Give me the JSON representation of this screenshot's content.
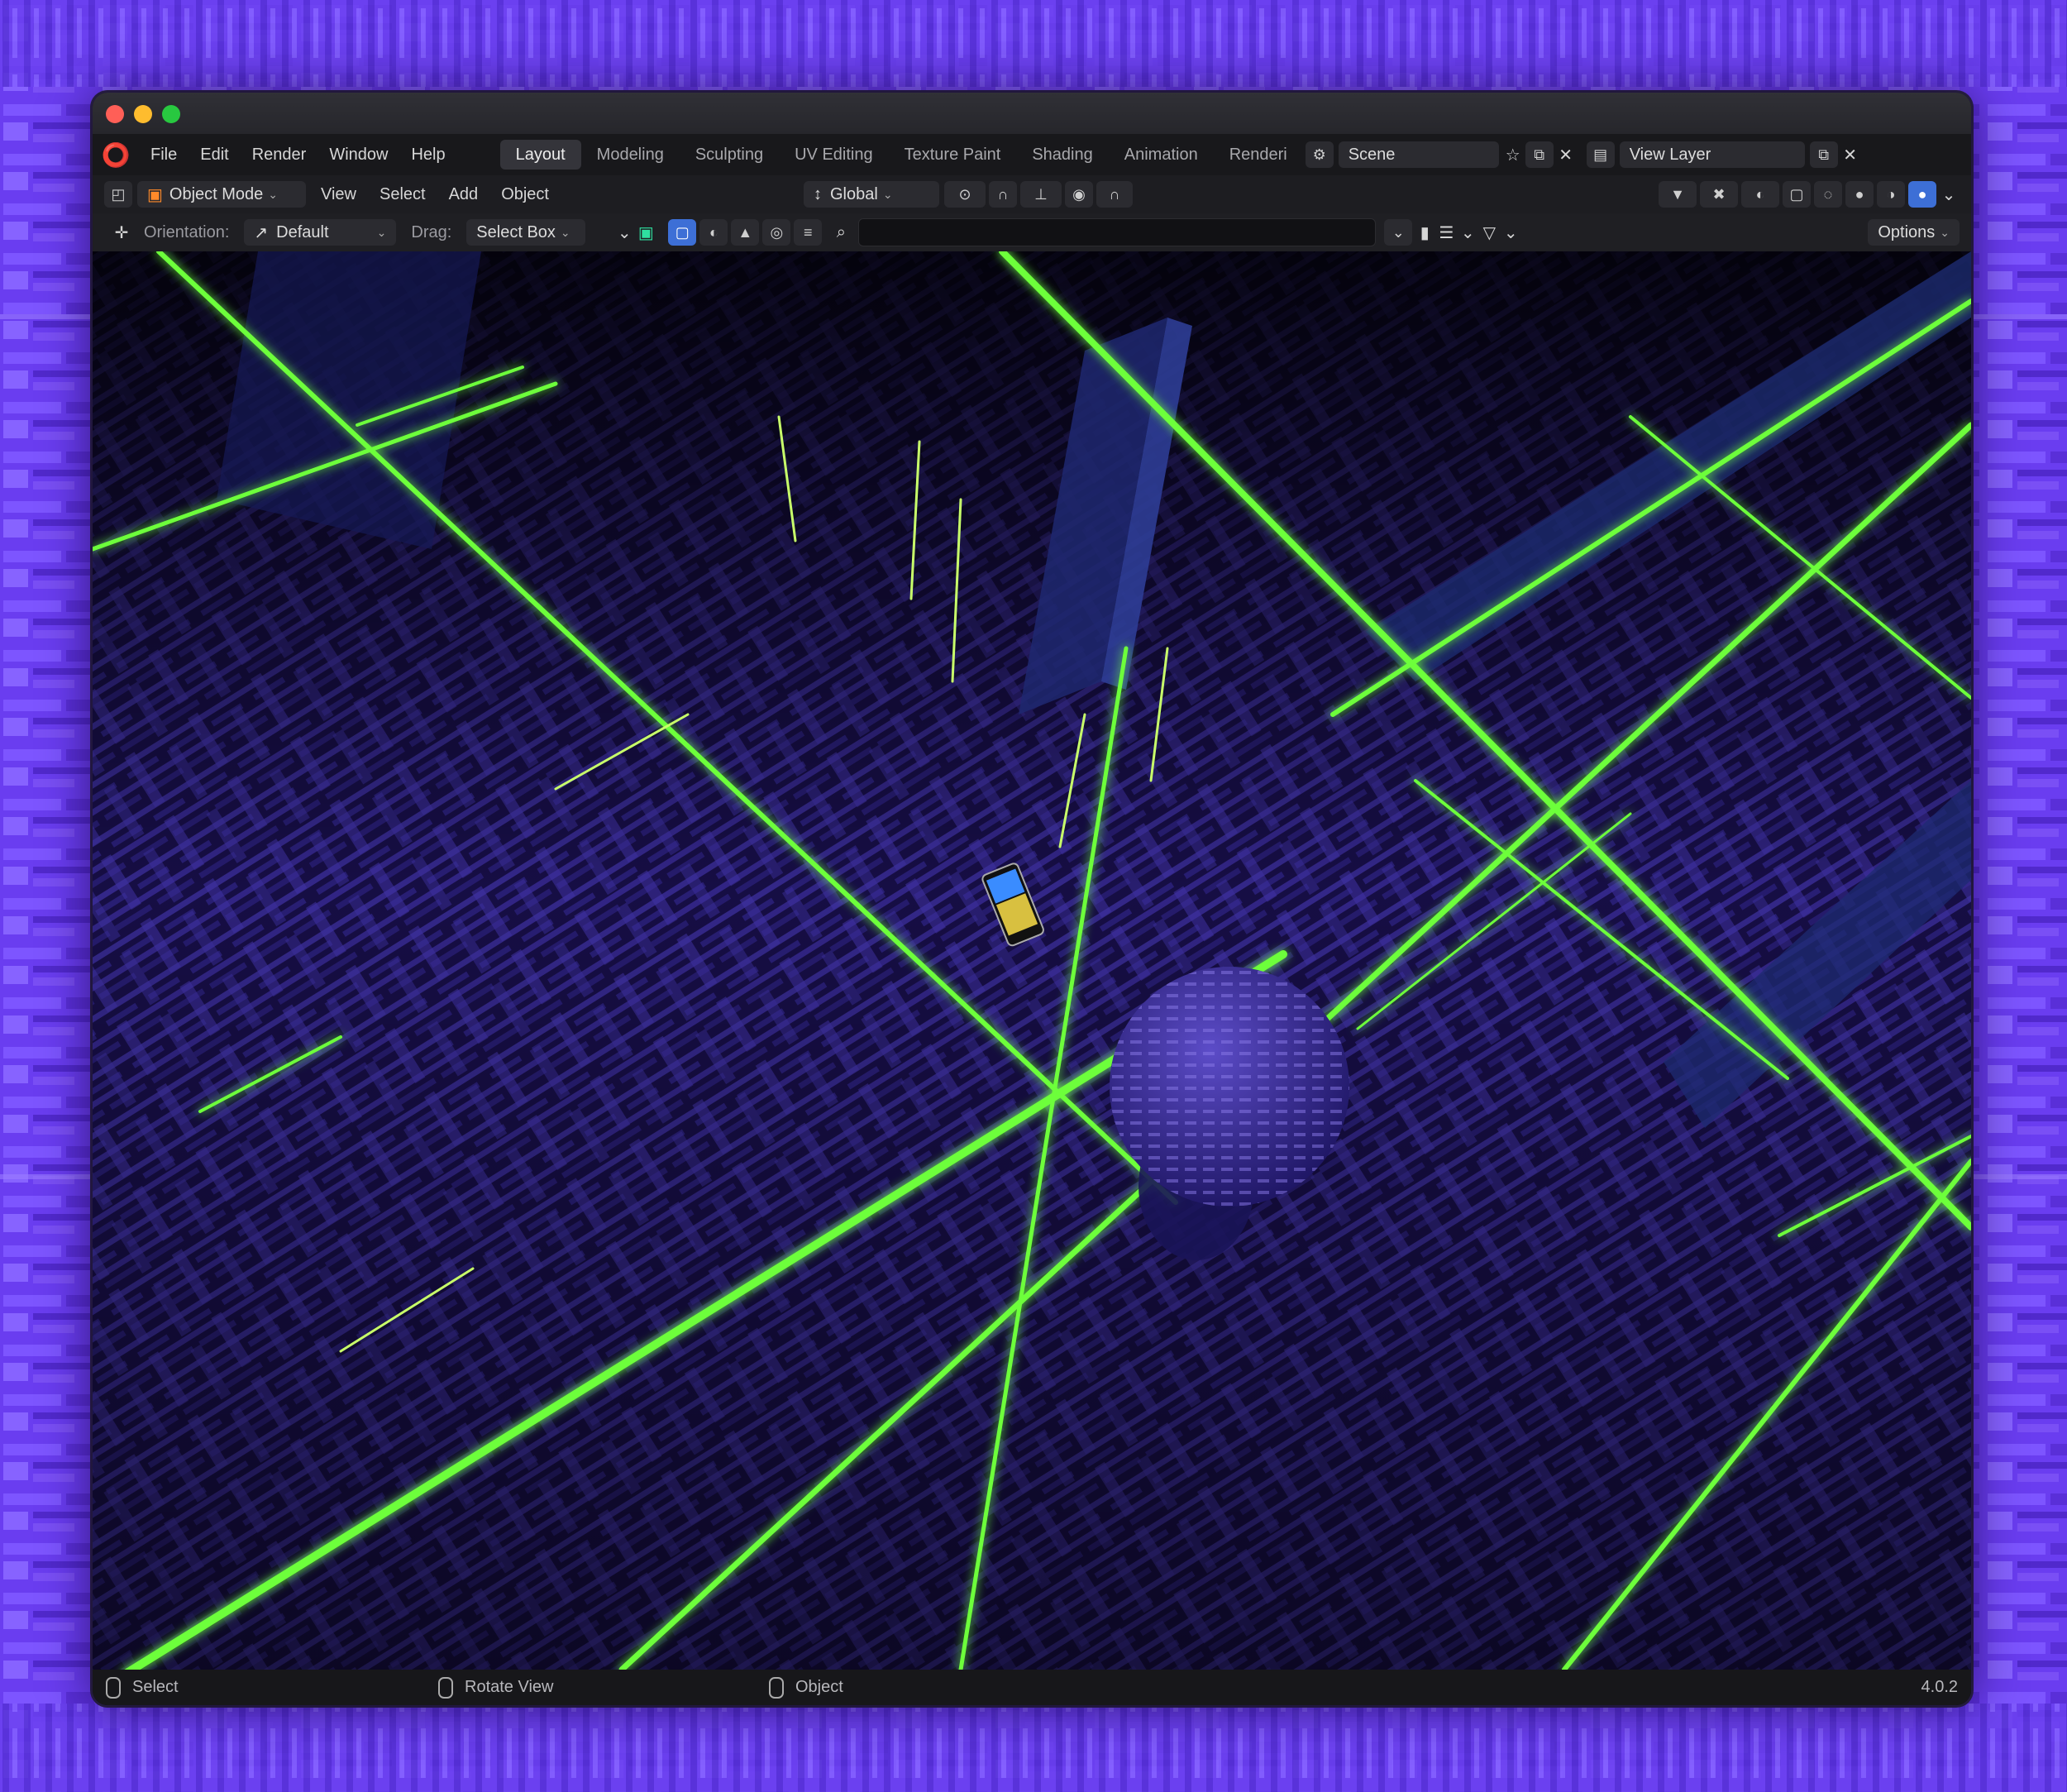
{
  "window": {
    "traffic_lights": {
      "close_color": "#ff5f57",
      "minimize_color": "#febc2e",
      "zoom_color": "#28c840"
    }
  },
  "menubar": {
    "logo_icon": "blender-logo-icon",
    "menus": [
      "File",
      "Edit",
      "Render",
      "Window",
      "Help"
    ],
    "tabs": [
      "Layout",
      "Modeling",
      "Sculpting",
      "UV Editing",
      "Texture Paint",
      "Shading",
      "Animation",
      "Renderi"
    ],
    "active_tab": "Layout",
    "scene_field": "Scene",
    "view_layer_field": "View Layer"
  },
  "header": {
    "editor_type_icon": "3d-viewport-icon",
    "mode": "Object Mode",
    "menus": [
      "View",
      "Select",
      "Add",
      "Object"
    ],
    "transform_orientation": "Global",
    "snap_icon": "magnet-icon",
    "proportional_icon": "proportional-edit-icon",
    "shading_icons": [
      "wireframe-icon",
      "solid-icon",
      "material-preview-icon",
      "rendered-icon"
    ]
  },
  "tool_header": {
    "orientation_label": "Orientation:",
    "orientation_value": "Default",
    "drag_label": "Drag:",
    "drag_value": "Select Box",
    "search_placeholder": "",
    "options_label": "Options"
  },
  "statusbar": {
    "select_label": "Select",
    "rotate_label": "Rotate View",
    "object_label": "Object",
    "version": "4.0.2"
  },
  "colors": {
    "accent_green": "#66ff33",
    "background_purple": "#6a3df0",
    "floor_blue": "#3f2ea8",
    "ui_dark": "#1d1d21",
    "active_blue": "#3d6fd6"
  }
}
